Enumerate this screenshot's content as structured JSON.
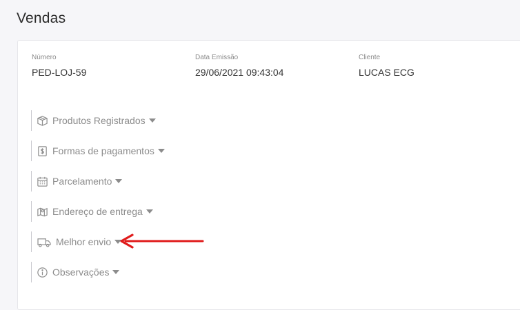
{
  "page": {
    "title": "Vendas"
  },
  "order": {
    "number_label": "Número",
    "number_value": "PED-LOJ-59",
    "date_label": "Data Emissão",
    "date_value": "29/06/2021 09:43:04",
    "client_label": "Cliente",
    "client_value": "LUCAS ECG"
  },
  "sections": [
    {
      "label": "Produtos Registrados",
      "icon": "box-icon"
    },
    {
      "label": "Formas de pagamentos",
      "icon": "dollar-icon"
    },
    {
      "label": "Parcelamento",
      "icon": "calendar-icon"
    },
    {
      "label": "Endereço de entrega",
      "icon": "map-icon"
    },
    {
      "label": "Melhor envio",
      "icon": "truck-icon"
    },
    {
      "label": "Observações",
      "icon": "info-icon"
    }
  ],
  "annotation": {
    "arrow_color": "#e01b1b",
    "arrow_target": "Melhor envio"
  }
}
